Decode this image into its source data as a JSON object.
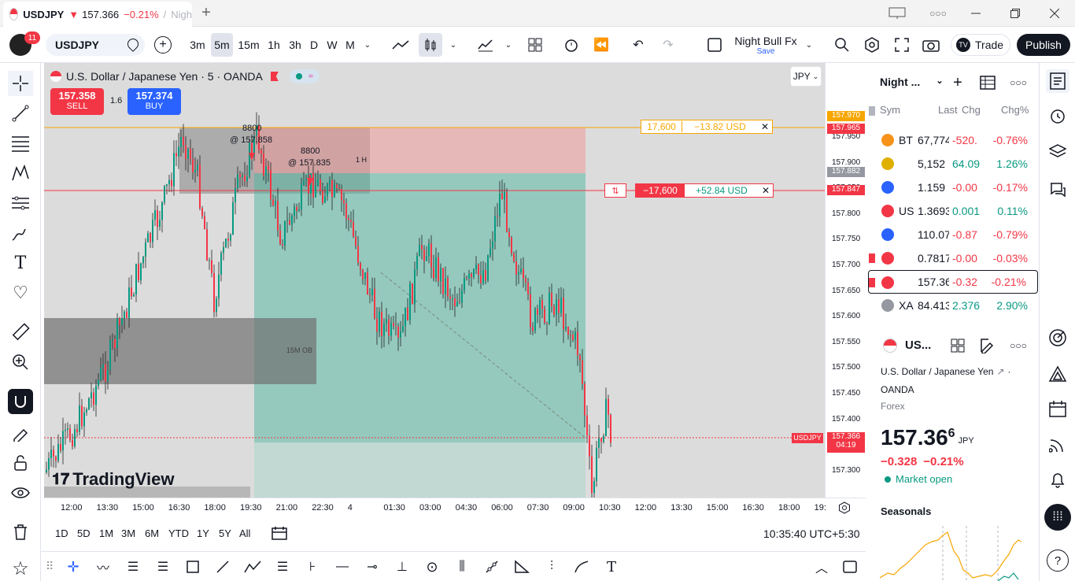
{
  "tab": {
    "symbol": "USDJPY",
    "arrow": "▼",
    "price": "157.366",
    "change": "−0.21%",
    "sep": "/",
    "layout": "Nigh"
  },
  "toolbar": {
    "badge": "11",
    "symbol": "USDJPY",
    "intervals": [
      "3m",
      "5m",
      "15m",
      "1h",
      "3h",
      "D",
      "W",
      "M"
    ],
    "layout_name": "Night Bull Fx",
    "save": "Save",
    "trade": "Trade",
    "publish": "Publish"
  },
  "legend": {
    "title": "U.S. Dollar / Japanese Yen · 5 · OANDA",
    "sell_price": "157.358",
    "sell": "SELL",
    "spread": "1.6",
    "buy_price": "157.374",
    "buy": "BUY",
    "currency": "JPY"
  },
  "annotations": {
    "lbl1a": "8800",
    "lbl1b": "@ 157.858",
    "lbl2a": "8800",
    "lbl2b": "@ 157.835",
    "tf1": "1 H",
    "ob": "15M OB",
    "order1_qty": "17,600",
    "order1_pl": "−13.82 USD",
    "order2_qty": "−17,600",
    "order2_pl": "+52.84 USD",
    "watermark": "TradingView",
    "ticker_tag": "USDJPY"
  },
  "price_axis": {
    "labels": [
      "157.950",
      "157.900",
      "157.850",
      "157.800",
      "157.750",
      "157.700",
      "157.650",
      "157.600",
      "157.550",
      "157.500",
      "157.450",
      "157.400",
      "157.350",
      "157.300"
    ],
    "tag1": "157.970",
    "tag2": "157.965",
    "tag3": "157.882",
    "tag4": "157.847",
    "tag_last": "157.366",
    "countdown": "04:19"
  },
  "time_axis": [
    "12:00",
    "13:30",
    "15:00",
    "16:30",
    "18:00",
    "19:30",
    "21:00",
    "22:30",
    "4",
    "01:30",
    "03:00",
    "04:30",
    "06:00",
    "07:30",
    "09:00",
    "10:30",
    "12:00",
    "13:30",
    "15:00",
    "16:30",
    "18:00",
    "19:"
  ],
  "ranges": [
    "1D",
    "5D",
    "1M",
    "3M",
    "6M",
    "YTD",
    "1Y",
    "5Y",
    "All"
  ],
  "clock": "10:35:40 UTC+5:30",
  "watchlist": {
    "title": "Night ...",
    "cols": [
      "Sym",
      "Last",
      "Chg",
      "Chg%"
    ],
    "rows": [
      {
        "sym": "BT",
        "last": "67,774",
        "chg": "-520.",
        "pct": "-0.76%",
        "color": "#f7931a",
        "neg": true
      },
      {
        "sym": "",
        "last": "5,152",
        "chg": "64.09",
        "pct": "1.26%",
        "color": "#e0b000",
        "neg": false
      },
      {
        "sym": "",
        "last": "1.159",
        "chg": "-0.00",
        "pct": "-0.17%",
        "color": "#2962ff",
        "neg": true
      },
      {
        "sym": "US",
        "last": "1.3693",
        "chg": "0.001",
        "pct": "0.11%",
        "color": "#f23645",
        "neg": false
      },
      {
        "sym": "",
        "last": "110.07",
        "chg": "-0.87",
        "pct": "-0.79%",
        "color": "#2962ff",
        "neg": true
      },
      {
        "sym": "",
        "last": "0.7817",
        "chg": "-0.00",
        "pct": "-0.03%",
        "color": "#f23645",
        "neg": true
      },
      {
        "sym": "",
        "last": "157.36",
        "chg": "-0.32",
        "pct": "-0.21%",
        "color": "#f23645",
        "neg": true
      },
      {
        "sym": "XA",
        "last": "84.413",
        "chg": "2.376",
        "pct": "2.90%",
        "color": "#9598a1",
        "neg": false
      }
    ]
  },
  "details": {
    "sym": "US...",
    "name": "U.S. Dollar / Japanese Yen",
    "dot": "·",
    "exchange": "OANDA",
    "category": "Forex",
    "price_main": "157.36",
    "price_sup": "6",
    "currency": "JPY",
    "chg": "−0.328",
    "chg_pct": "−0.21%",
    "status": "Market open",
    "seasonals": "Seasonals"
  },
  "colors": {
    "up": "#089981",
    "down": "#f23645",
    "accent": "#2962ff"
  }
}
